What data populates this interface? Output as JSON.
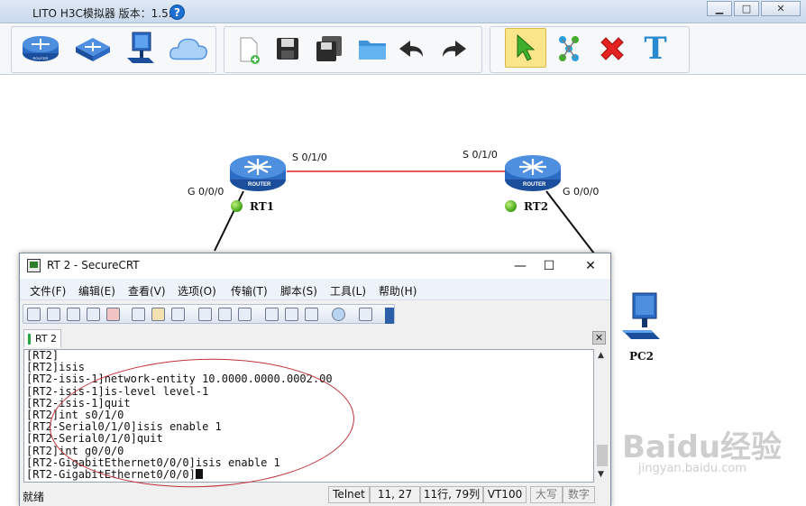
{
  "app": {
    "title": "LITO H3C模拟器 版本：1.5.2",
    "help_glyph": "?",
    "window_controls": [
      "▁",
      "□",
      "✕"
    ]
  },
  "toolbar": {
    "icons": [
      "router-icon",
      "switch-icon",
      "pc-icon",
      "cloud-icon",
      "new-file-icon",
      "save-icon",
      "save-as-icon",
      "open-folder-icon",
      "undo-icon",
      "redo-icon",
      "select-pointer-icon",
      "connect-icon",
      "delete-icon",
      "text-icon"
    ],
    "text_tool_glyph": "T"
  },
  "topology": {
    "router_badge": "ROUTER",
    "devices": {
      "rt1": {
        "name": "RT1"
      },
      "rt2": {
        "name": "RT2"
      },
      "pc2": {
        "name": "PC2"
      }
    },
    "interfaces": {
      "rt1_g": "G 0/0/0",
      "rt1_s": "S 0/1/0",
      "rt2_s": "S 0/1/0",
      "rt2_g": "G 0/0/0"
    },
    "colors": {
      "serial_link": "#e02020",
      "ethernet_link": "#111111",
      "status_up": "#3ea112"
    }
  },
  "securecrt": {
    "title": "RT 2 - SecureCRT",
    "controls": [
      "—",
      "☐",
      "✕"
    ],
    "menu": [
      "文件(F)",
      "编辑(E)",
      "查看(V)",
      "选项(O)",
      "传输(T)",
      "脚本(S)",
      "工具(L)",
      "帮助(H)"
    ],
    "tab_label": "RT 2",
    "tab_close": "✕",
    "terminal_lines": [
      "[RT2]",
      "[RT2]isis",
      "[RT2-isis-1]network-entity 10.0000.0000.0002.00",
      "[RT2-isis-1]is-level level-1",
      "[RT2-isis-1]quit",
      "[RT2]int s0/1/0",
      "[RT2-Serial0/1/0]isis enable 1",
      "[RT2-Serial0/1/0]quit",
      "[RT2]int g0/0/0",
      "[RT2-GigabitEthernet0/0/0]isis enable 1",
      "[RT2-GigabitEthernet0/0/0]"
    ],
    "status": {
      "ready": "就绪",
      "protocol": "Telnet",
      "cursor_pos": "11,  27",
      "rows_cols": "11行, 79列",
      "terminal": "VT100",
      "caps": "大写",
      "num": "数字"
    }
  },
  "watermark": {
    "brand": "Baidu经验",
    "url": "jingyan.baidu.com"
  }
}
